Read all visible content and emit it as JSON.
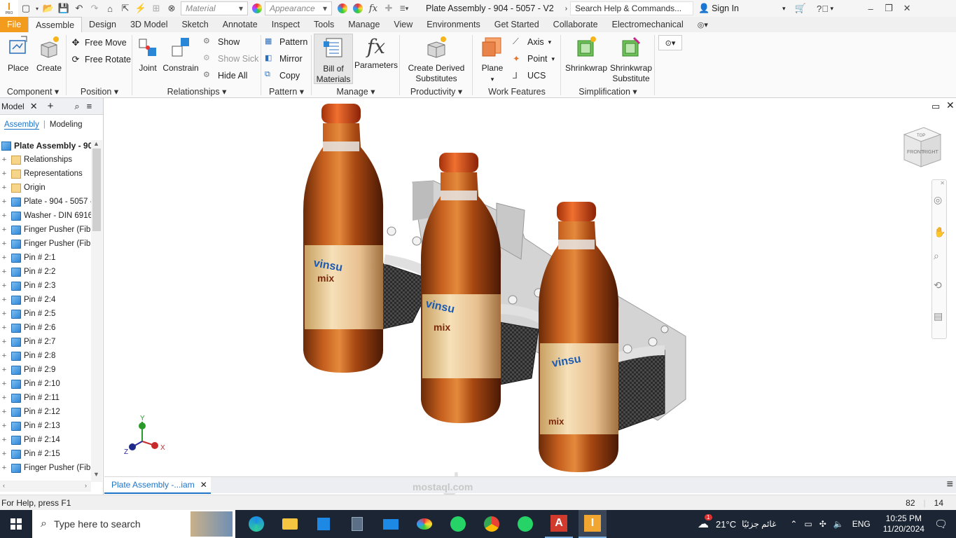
{
  "titlebar": {
    "material_placeholder": "Material",
    "appearance_placeholder": "Appearance",
    "fx_label": "fx",
    "document_title": "Plate Assembly - 904 - 5057 - V2",
    "search_placeholder": "Search Help & Commands...",
    "sign_in": "Sign In",
    "app_logo_text": "I",
    "app_logo_sub": "PRO"
  },
  "tabs": [
    "File",
    "Assemble",
    "Design",
    "3D Model",
    "Sketch",
    "Annotate",
    "Inspect",
    "Tools",
    "Manage",
    "View",
    "Environments",
    "Get Started",
    "Collaborate",
    "Electromechanical"
  ],
  "ribbon": {
    "component": {
      "place": "Place",
      "create": "Create",
      "label": "Component"
    },
    "position": {
      "free_move": "Free Move",
      "free_rotate": "Free Rotate",
      "label": "Position"
    },
    "relationships": {
      "joint": "Joint",
      "constrain": "Constrain",
      "show": "Show",
      "show_sick": "Show Sick",
      "hide_all": "Hide All",
      "label": "Relationships"
    },
    "pattern": {
      "pattern": "Pattern",
      "mirror": "Mirror",
      "copy": "Copy",
      "label": "Pattern"
    },
    "manage": {
      "bom_line1": "Bill of",
      "bom_line2": "Materials",
      "parameters": "Parameters",
      "param_icon": "fx",
      "label": "Manage"
    },
    "productivity": {
      "line1": "Create Derived",
      "line2": "Substitutes",
      "label": "Productivity"
    },
    "work_features": {
      "plane": "Plane",
      "axis": "Axis",
      "point": "Point",
      "ucs": "UCS",
      "label": "Work Features"
    },
    "simplification": {
      "shrinkwrap": "Shrinkwrap",
      "sub_line1": "Shrinkwrap",
      "sub_line2": "Substitute",
      "label": "Simplification"
    }
  },
  "browser": {
    "title": "Model",
    "tab_assembly": "Assembly",
    "tab_modeling": "Modeling",
    "root": "Plate Assembly - 90",
    "items": [
      {
        "label": "Relationships",
        "icon": "folder"
      },
      {
        "label": "Representations",
        "icon": "representations"
      },
      {
        "label": "Origin",
        "icon": "folder"
      },
      {
        "label": "Plate - 904 - 5057 -",
        "icon": "part"
      },
      {
        "label": "Washer - DIN 6916",
        "icon": "fastener"
      },
      {
        "label": "Finger Pusher  (Fib",
        "icon": "part"
      },
      {
        "label": "Finger Pusher  (Fib",
        "icon": "part"
      },
      {
        "label": "Pin # 2:1",
        "icon": "part"
      },
      {
        "label": "Pin # 2:2",
        "icon": "part"
      },
      {
        "label": "Pin # 2:3",
        "icon": "part"
      },
      {
        "label": "Pin # 2:4",
        "icon": "part"
      },
      {
        "label": "Pin # 2:5",
        "icon": "part"
      },
      {
        "label": "Pin # 2:6",
        "icon": "part"
      },
      {
        "label": "Pin # 2:7",
        "icon": "part"
      },
      {
        "label": "Pin # 2:8",
        "icon": "part"
      },
      {
        "label": "Pin # 2:9",
        "icon": "part"
      },
      {
        "label": "Pin # 2:10",
        "icon": "part"
      },
      {
        "label": "Pin # 2:11",
        "icon": "part"
      },
      {
        "label": "Pin # 2:12",
        "icon": "part"
      },
      {
        "label": "Pin # 2:13",
        "icon": "part"
      },
      {
        "label": "Pin # 2:14",
        "icon": "part"
      },
      {
        "label": "Pin # 2:15",
        "icon": "part"
      },
      {
        "label": "Finger Pusher  (Fib",
        "icon": "part"
      }
    ]
  },
  "viewcube": {
    "front": "FRONT",
    "right": "RIGHT",
    "top": "TOP"
  },
  "triad": {
    "x": "X",
    "y": "Y",
    "z": "Z"
  },
  "bottle_labels": [
    "vinsu",
    "mix",
    "vinsu",
    "mix",
    "vinsu",
    "mix"
  ],
  "document_tab": "Plate Assembly -...iam",
  "status": {
    "help": "For Help, press F1",
    "count1": "82",
    "count2": "14"
  },
  "taskbar": {
    "search_placeholder": "Type here to search",
    "weather_temp": "21°C",
    "weather_text": "غائم جزئيًا",
    "language": "ENG",
    "time": "10:25 PM",
    "date": "11/20/2024",
    "notification_count": "1"
  },
  "watermark": {
    "line1": "مستقل",
    "line2": "mostaql.com"
  },
  "colors": {
    "file_tab": "#f29b1d",
    "accent_blue": "#1f74c8",
    "taskbar": "#1b2533",
    "bottle_amber": "#b4551a",
    "cap_orange": "#e8541c"
  }
}
